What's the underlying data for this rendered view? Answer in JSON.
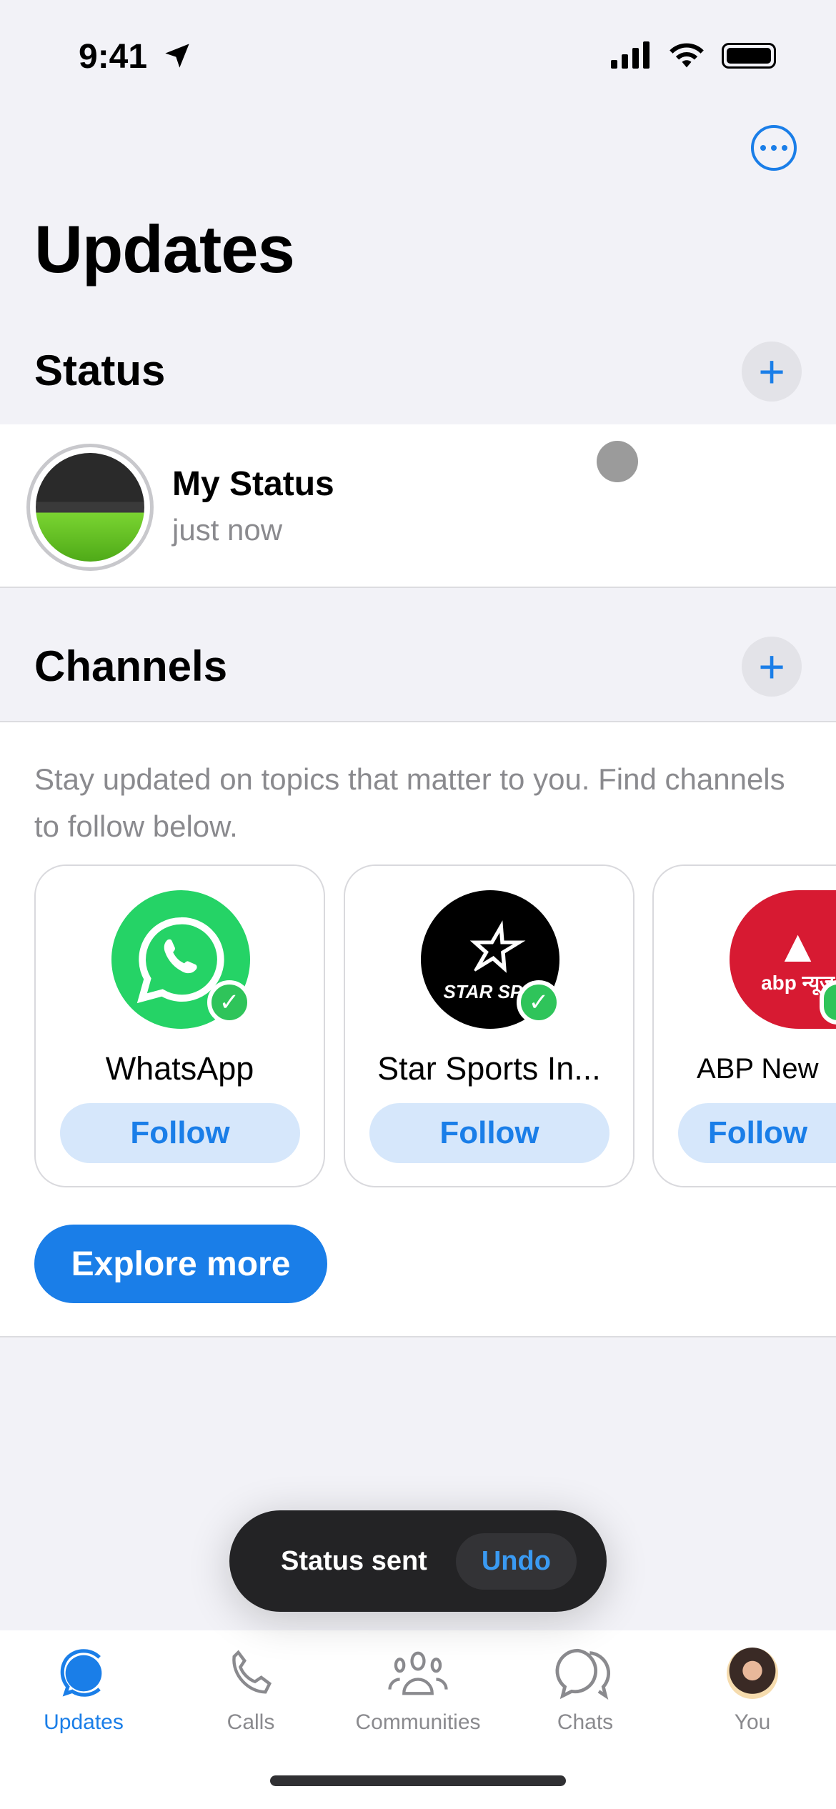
{
  "status_bar": {
    "time": "9:41"
  },
  "header": {
    "title": "Updates",
    "more_icon": "ellipsis-circle-icon"
  },
  "status": {
    "heading": "Status",
    "my_status": "My Status",
    "subtitle": "just now"
  },
  "channels": {
    "heading": "Channels",
    "description": "Stay updated on topics that matter to you. Find channels to follow below.",
    "cards": [
      {
        "name": "WhatsApp",
        "follow": "Follow",
        "logo_color": "#25d366"
      },
      {
        "name": "Star Sports In...",
        "follow": "Follow",
        "logo_color": "#000000",
        "logo_text": "STAR SPO"
      },
      {
        "name": "ABP New",
        "follow": "Follow",
        "logo_color": "#d71a32",
        "logo_text": "abp न्यूज़"
      }
    ],
    "explore": "Explore more"
  },
  "toast": {
    "message": "Status sent",
    "action": "Undo"
  },
  "tabs": [
    {
      "label": "Updates",
      "active": true
    },
    {
      "label": "Calls"
    },
    {
      "label": "Communities"
    },
    {
      "label": "Chats"
    },
    {
      "label": "You"
    }
  ],
  "colors": {
    "accent": "#1a7ee8",
    "verified": "#2fc45a"
  }
}
